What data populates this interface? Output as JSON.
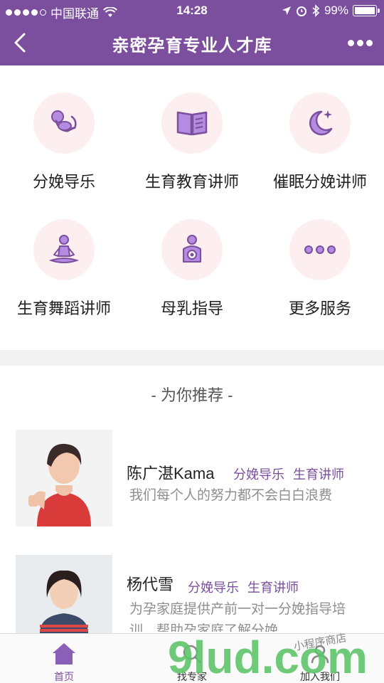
{
  "status_bar": {
    "carrier": "中国联通",
    "time": "14:28",
    "battery_percent": "99%",
    "battery_level": 0.99
  },
  "nav": {
    "title": "亲密孕育专业人才库",
    "back_icon": "chevron-left-icon",
    "more_icon": "more-dots-icon"
  },
  "services": [
    {
      "label": "分娩导乐",
      "icon": "baby-icon"
    },
    {
      "label": "生育教育讲师",
      "icon": "book-icon"
    },
    {
      "label": "催眠分娩讲师",
      "icon": "moon-icon"
    },
    {
      "label": "生育舞蹈讲师",
      "icon": "meditation-icon"
    },
    {
      "label": "母乳指导",
      "icon": "breastfeeding-icon"
    },
    {
      "label": "更多服务",
      "icon": "more-icon"
    }
  ],
  "recommend": {
    "title": "- 为你推荐 -",
    "experts": [
      {
        "name": "陈广湛Kama",
        "tags": [
          "分娩导乐",
          "生育讲师"
        ],
        "desc": "我们每个人的努力都不会白白浪费"
      },
      {
        "name": "杨代雪",
        "tags": [
          "分娩导乐",
          "生育讲师"
        ],
        "desc": "为孕家庭提供产前一对一分娩指导培训，帮助孕家庭了解分娩"
      }
    ]
  },
  "tabbar": {
    "items": [
      {
        "label": "首页",
        "icon": "home-icon",
        "active": true
      },
      {
        "label": "找专家",
        "icon": "find-expert-icon",
        "active": false
      },
      {
        "label": "加入我们",
        "icon": "join-icon",
        "active": false
      }
    ]
  },
  "watermark": {
    "brand": "9lud.com",
    "sub": "小程序商店"
  },
  "colors": {
    "brand": "#7b4f9e",
    "icon_bg": "#fdeef0",
    "icon_fg": "#b48be0"
  }
}
